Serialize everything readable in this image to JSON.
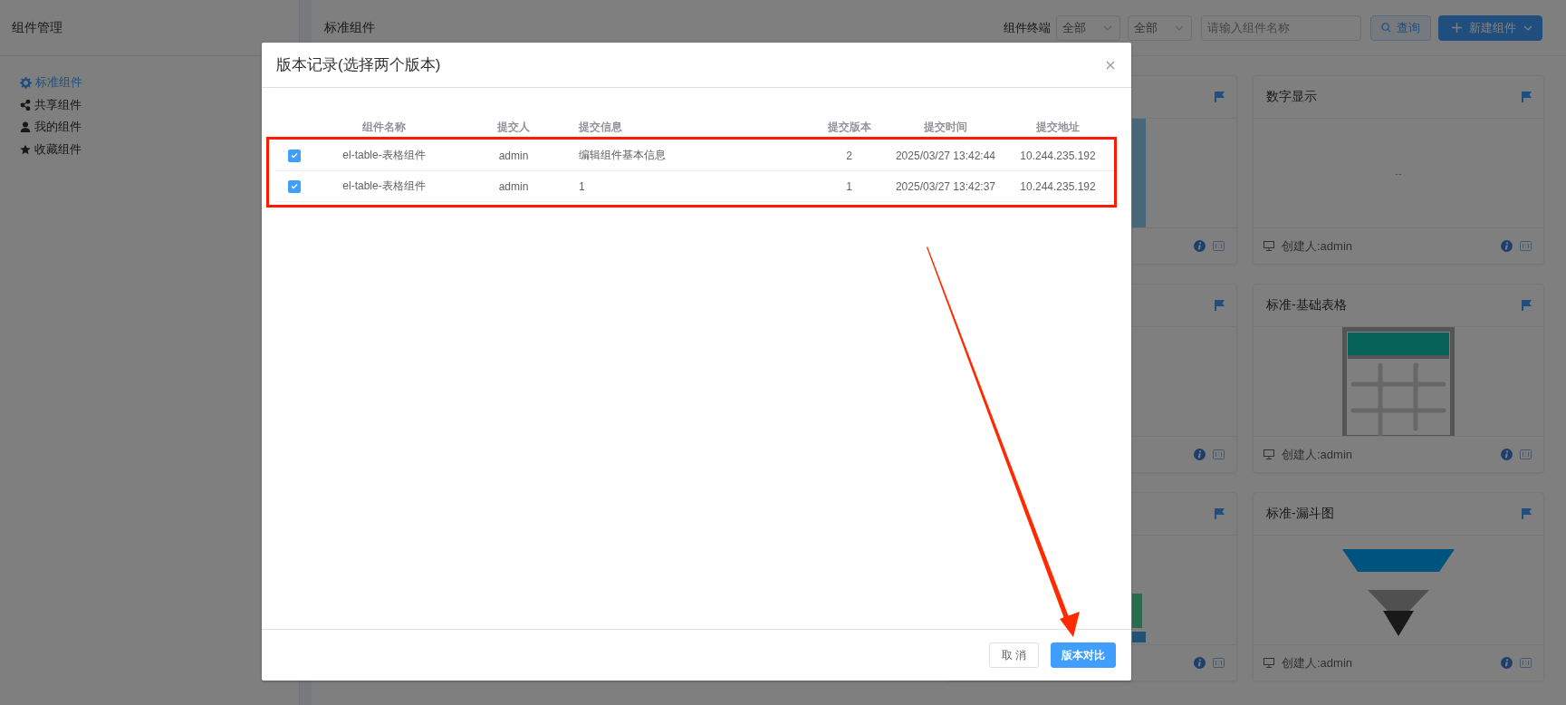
{
  "sidebar": {
    "title": "组件管理",
    "items": [
      {
        "label": "标准组件",
        "kind": "gear",
        "selected": true
      },
      {
        "label": "共享组件",
        "kind": "share",
        "selected": false
      },
      {
        "label": "我的组件",
        "kind": "user",
        "selected": false
      },
      {
        "label": "收藏组件",
        "kind": "star",
        "selected": false
      }
    ]
  },
  "toolbar": {
    "title": "标准组件",
    "filter_label": "组件终端",
    "selects": [
      {
        "value": "全部"
      },
      {
        "value": "全部"
      }
    ],
    "search": {
      "placeholder": "请输入组件名称"
    },
    "buttons": [
      {
        "label": "查询",
        "kind": "search"
      },
      {
        "label": "新建组件",
        "kind": "create"
      }
    ]
  },
  "cards": [
    {
      "kind": "bars"
    },
    {
      "title": "数字显示",
      "kind": "number",
      "value": "--",
      "creator": "创建人:admin"
    },
    {
      "kind": "blank"
    },
    {
      "title": "标准-基础表格",
      "kind": "table",
      "creator": "创建人:admin"
    },
    {
      "kind": "columns"
    },
    {
      "title": "标准-漏斗图",
      "kind": "funnel",
      "creator": "创建人:admin"
    }
  ],
  "dialog": {
    "title": "版本记录(选择两个版本)",
    "columns": [
      "组件名称",
      "提交人",
      "提交信息",
      "提交版本",
      "提交时间",
      "提交地址"
    ],
    "rows": [
      {
        "checked": true,
        "cells": [
          "el-table-表格组件",
          "admin",
          "编辑组件基本信息",
          "2",
          "2025/03/27 13:42:44",
          "10.244.235.192"
        ]
      },
      {
        "checked": true,
        "cells": [
          "el-table-表格组件",
          "admin",
          "1",
          "1",
          "2025/03/27 13:42:37",
          "10.244.235.192"
        ]
      }
    ],
    "buttons": [
      {
        "label": "取 消",
        "kind": "default"
      },
      {
        "label": "版本对比",
        "kind": "primary"
      }
    ]
  }
}
